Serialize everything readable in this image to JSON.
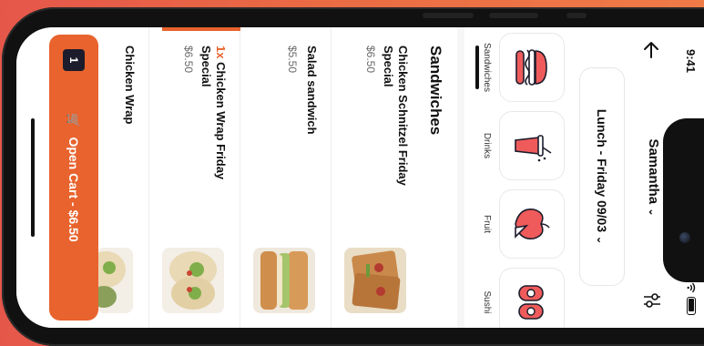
{
  "status_bar": {
    "time": "9:41"
  },
  "header": {
    "user": "Samantha",
    "menu": "Lunch - Friday 09/03"
  },
  "categories": [
    {
      "label": "Sandwiches",
      "icon": "sandwich-icon",
      "active": true
    },
    {
      "label": "Drinks",
      "icon": "drink-icon",
      "active": false
    },
    {
      "label": "Fruit",
      "icon": "apple-icon",
      "active": false
    },
    {
      "label": "Sushi",
      "icon": "sushi-icon",
      "active": false
    }
  ],
  "section": {
    "title": "Sandwiches"
  },
  "items": [
    {
      "qty": "",
      "name": "Chicken Schnitzel Friday Special",
      "price": "$6.50",
      "active": false
    },
    {
      "qty": "",
      "name": "Salad sandwich",
      "price": "$5.50",
      "active": false
    },
    {
      "qty": "1x",
      "name": "Chicken Wrap Friday Special",
      "price": "$6.50",
      "active": true
    },
    {
      "qty": "",
      "name": "Chicken Wrap",
      "price": "",
      "active": false
    }
  ],
  "cart": {
    "count": "1",
    "label": "Open Cart - $6.50",
    "icon": "cart-icon"
  },
  "colors": {
    "accent": "#e8632d",
    "background": "#ea6a44"
  }
}
